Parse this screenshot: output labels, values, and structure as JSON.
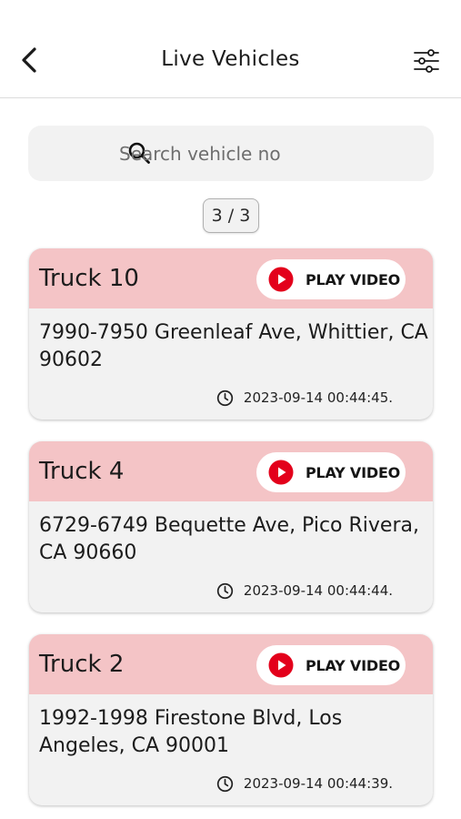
{
  "header": {
    "title": "Live Vehicles"
  },
  "search": {
    "placeholder": "Search vehicle no"
  },
  "counter": {
    "text": "3 / 3"
  },
  "play_label": "PLAY VIDEO",
  "vehicles": [
    {
      "name": "Truck 10",
      "address": "7990-7950 Greenleaf Ave, Whittier, CA 90602",
      "timestamp": "2023-09-14 00:44:45."
    },
    {
      "name": "Truck 4",
      "address": "6729-6749 Bequette Ave, Pico Rivera, CA 90660",
      "timestamp": "2023-09-14 00:44:44."
    },
    {
      "name": "Truck 2",
      "address": "1992-1998 Firestone Blvd, Los Angeles, CA 90001",
      "timestamp": "2023-09-14 00:44:39."
    }
  ],
  "colors": {
    "card_header": "#f4c4c6",
    "play_icon": "#e3001b",
    "card_bg": "#f2f2f2"
  },
  "icons": {
    "back": "chevron-left-icon",
    "filter": "sliders-icon",
    "search": "search-icon",
    "play": "play-circle-icon",
    "clock": "clock-icon"
  }
}
